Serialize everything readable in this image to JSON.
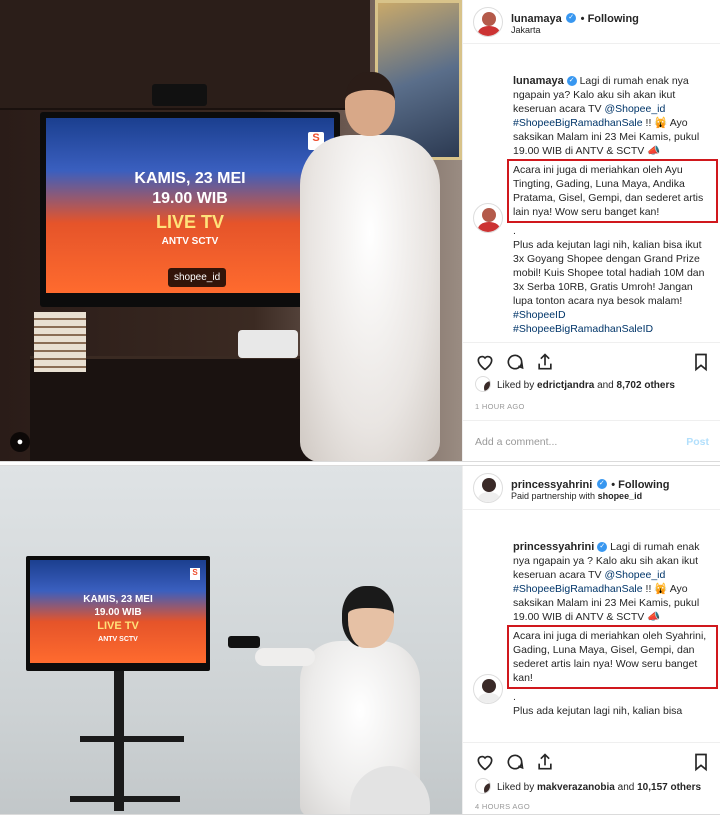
{
  "post1": {
    "username": "lunamaya",
    "follow_label": "• Following",
    "location": "Jakarta",
    "caption_user": "lunamaya",
    "caption_intro": "Lagi di rumah enak nya ngapain ya? Kalo aku sih akan ikut keseruan acara TV",
    "mention": "@Shopee_id",
    "hashtag1": "#ShopeeBigRamadhanSale",
    "caption_mid": "!! 🙀 Ayo saksikan Malam ini 23 Mei Kamis, pukul 19.00 WIB di ANTV & SCTV 📣",
    "highlight": "Acara ini juga di meriahkan oleh Ayu Tingting, Gading, Luna Maya, Andika Pratama, Gisel, Gempi, dan sederet artis lain nya! Wow seru banget kan!",
    "dot": ".",
    "caption_end": "Plus ada kejutan lagi nih, kalian bisa ikut 3x Goyang Shopee dengan Grand Prize mobil! Kuis Shopee total hadiah 10M dan 3x Serba 10RB, Gratis Umroh! Jangan lupa tonton acara nya besok malam!",
    "hashtag2": "#ShopeeID",
    "hashtag3": "#ShopeeBigRamadhanSaleID",
    "liked_by_label": "Liked by",
    "liked_user": "edrictjandra",
    "likes_and": "and",
    "likes_count": "8,702 others",
    "time": "1 HOUR AGO",
    "comment_placeholder": "Add a comment...",
    "post_label": "Post",
    "tv": {
      "line1": "KAMIS, 23 MEI",
      "line2": "19.00 WIB",
      "line3": "LIVE TV",
      "channels": "ANTV  SCTV",
      "tag": "shopee_id"
    }
  },
  "post2": {
    "username": "princessyahrini",
    "follow_label": "• Following",
    "partner_label": "Paid partnership with",
    "partner": "shopee_id",
    "caption_user": "princessyahrini",
    "caption_intro": "Lagi di rumah enak nya ngapain ya ? Kalo aku sih akan ikut keseruan acara TV",
    "mention": "@Shopee_id",
    "hashtag1": "#ShopeeBigRamadhanSale",
    "caption_mid": "!! 🙀 Ayo saksikan Malam ini 23 Mei Kamis, pukul 19.00 WIB di ANTV & SCTV 📣",
    "highlight": "Acara ini juga di meriahkan oleh Syahrini, Gading, Luna Maya, Gisel, Gempi, dan sederet artis lain nya! Wow seru banget kan!",
    "dot": ".",
    "caption_end": "Plus ada kejutan lagi nih, kalian bisa",
    "liked_by_label": "Liked by",
    "liked_user": "makverazanobia",
    "likes_and": "and",
    "likes_count": "10,157 others",
    "time": "4 HOURS AGO",
    "tv": {
      "line1": "KAMIS, 23 MEI",
      "line2": "19.00 WIB",
      "line3": "LIVE TV",
      "channels": "ANTV  SCTV"
    }
  }
}
